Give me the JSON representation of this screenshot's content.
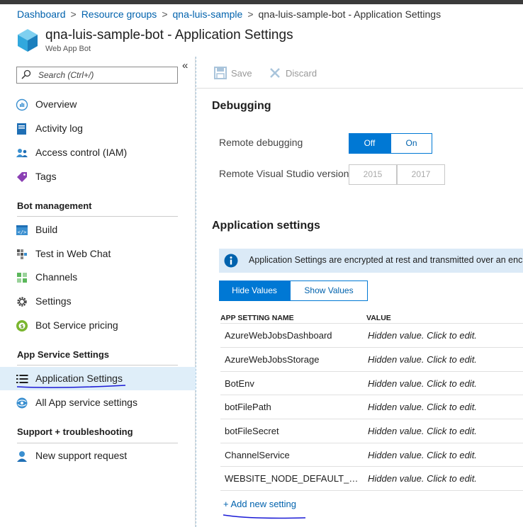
{
  "breadcrumb": {
    "items": [
      "Dashboard",
      "Resource groups",
      "qna-luis-sample"
    ],
    "current": "qna-luis-sample-bot - Application Settings"
  },
  "header": {
    "title": "qna-luis-sample-bot - Application Settings",
    "subtitle": "Web App Bot"
  },
  "sidebar": {
    "search_placeholder": "Search (Ctrl+/)",
    "collapse_glyph": "«",
    "items_top": [
      {
        "label": "Overview",
        "icon": "overview-icon"
      },
      {
        "label": "Activity log",
        "icon": "activity-log-icon"
      },
      {
        "label": "Access control (IAM)",
        "icon": "access-control-icon"
      },
      {
        "label": "Tags",
        "icon": "tag-icon"
      }
    ],
    "section_bot": "Bot management",
    "items_bot": [
      {
        "label": "Build",
        "icon": "build-icon"
      },
      {
        "label": "Test in Web Chat",
        "icon": "web-chat-icon"
      },
      {
        "label": "Channels",
        "icon": "channels-icon"
      },
      {
        "label": "Settings",
        "icon": "gear-icon"
      },
      {
        "label": "Bot Service pricing",
        "icon": "pricing-icon"
      }
    ],
    "section_app": "App Service Settings",
    "items_app": [
      {
        "label": "Application Settings",
        "icon": "list-icon",
        "active": true
      },
      {
        "label": "All App service settings",
        "icon": "app-service-icon"
      }
    ],
    "section_support": "Support + troubleshooting",
    "items_support": [
      {
        "label": "New support request",
        "icon": "support-request-icon"
      }
    ]
  },
  "toolbar": {
    "save_label": "Save",
    "discard_label": "Discard"
  },
  "debugging": {
    "heading": "Debugging",
    "remote_debugging_label": "Remote debugging",
    "remote_debugging_options": [
      "Off",
      "On"
    ],
    "remote_debugging_selected": "Off",
    "vs_version_label": "Remote Visual Studio version",
    "vs_version_options": [
      "2015",
      "2017"
    ]
  },
  "app_settings": {
    "heading": "Application settings",
    "info_text": "Application Settings are encrypted at rest and transmitted over an encrypted channel.",
    "hide_values_label": "Hide Values",
    "show_values_label": "Show Values",
    "col_name": "APP SETTING NAME",
    "col_value": "VALUE",
    "rows": [
      {
        "name": "AzureWebJobsDashboard",
        "value": "Hidden value. Click to edit."
      },
      {
        "name": "AzureWebJobsStorage",
        "value": "Hidden value. Click to edit."
      },
      {
        "name": "BotEnv",
        "value": "Hidden value. Click to edit."
      },
      {
        "name": "botFilePath",
        "value": "Hidden value. Click to edit."
      },
      {
        "name": "botFileSecret",
        "value": "Hidden value. Click to edit."
      },
      {
        "name": "ChannelService",
        "value": "Hidden value. Click to edit."
      },
      {
        "name": "WEBSITE_NODE_DEFAULT_VERSION",
        "value": "Hidden value. Click to edit."
      }
    ],
    "add_label": "+ Add new setting"
  },
  "colors": {
    "accent": "#0078d4",
    "link": "#0062ad",
    "active_nav": "#dfeef9",
    "info_bar": "#dbeaf7",
    "annotation_ink": "#1a1ad6"
  }
}
